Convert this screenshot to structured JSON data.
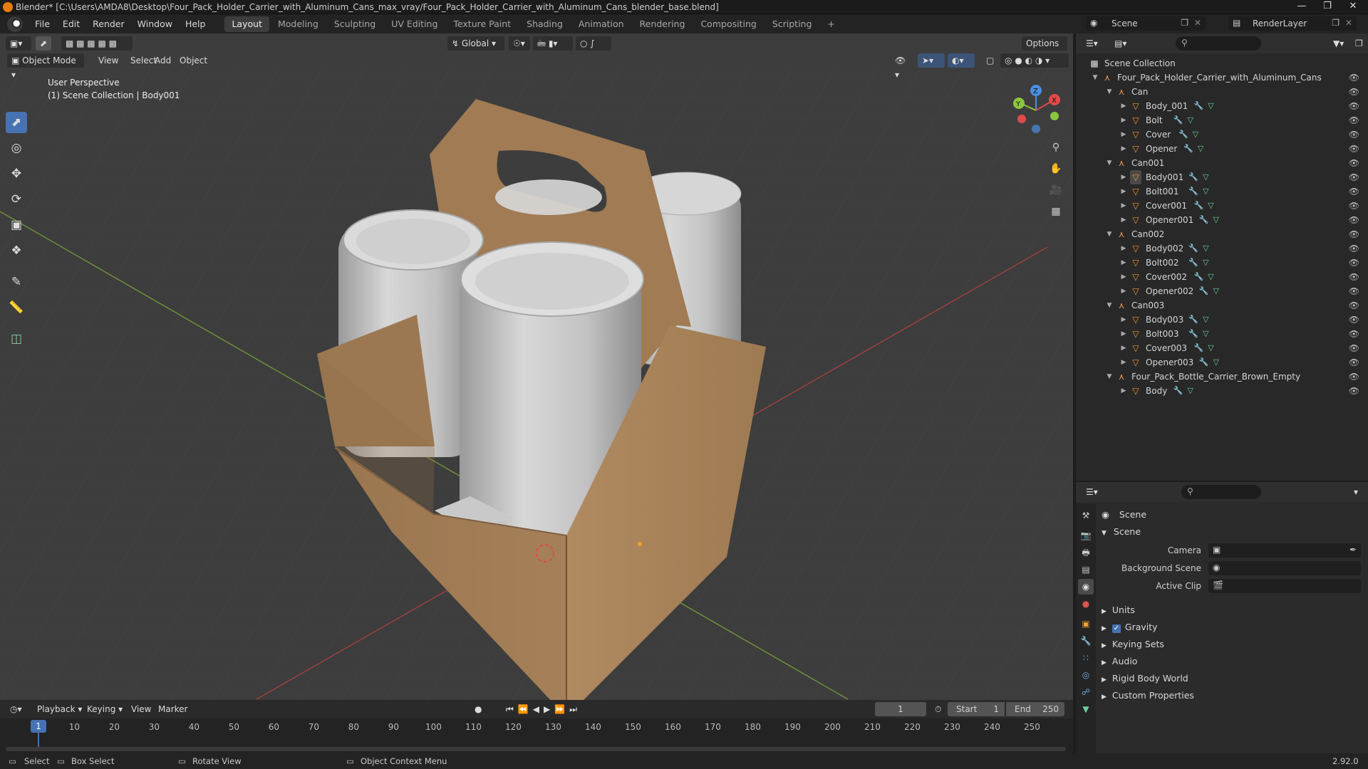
{
  "titlebar": {
    "text": "Blender* [C:\\Users\\AMDA8\\Desktop\\Four_Pack_Holder_Carrier_with_Aluminum_Cans_max_vray/Four_Pack_Holder_Carrier_with_Aluminum_Cans_blender_base.blend]"
  },
  "menubar": {
    "menus": [
      "File",
      "Edit",
      "Render",
      "Window",
      "Help"
    ],
    "workspaces": [
      "Layout",
      "Modeling",
      "Sculpting",
      "UV Editing",
      "Texture Paint",
      "Shading",
      "Animation",
      "Rendering",
      "Compositing",
      "Scripting"
    ],
    "active_workspace": "Layout",
    "add_tab": "+",
    "scene_name": "Scene",
    "layer_name": "RenderLayer"
  },
  "viewport": {
    "mode": "Object Mode",
    "menus": [
      "View",
      "Select",
      "Add",
      "Object"
    ],
    "transform_orientation": "Global",
    "options": "Options",
    "info_line1": "User Perspective",
    "info_line2": "(1) Scene Collection | Body001",
    "axes": {
      "x": "X",
      "y": "Y",
      "z": "Z"
    }
  },
  "outliner": {
    "root": "Scene Collection",
    "rows": [
      {
        "label": "Four_Pack_Holder_Carrier_with_Aluminum_Cans",
        "depth": 0,
        "type": "empty",
        "expanded": true
      },
      {
        "label": "Can",
        "depth": 1,
        "type": "empty",
        "expanded": true
      },
      {
        "label": "Body_001",
        "depth": 2,
        "type": "mesh"
      },
      {
        "label": "Bolt",
        "depth": 2,
        "type": "mesh"
      },
      {
        "label": "Cover",
        "depth": 2,
        "type": "mesh"
      },
      {
        "label": "Opener",
        "depth": 2,
        "type": "mesh"
      },
      {
        "label": "Can001",
        "depth": 1,
        "type": "empty",
        "expanded": true
      },
      {
        "label": "Body001",
        "depth": 2,
        "type": "mesh",
        "selected": true
      },
      {
        "label": "Bolt001",
        "depth": 2,
        "type": "mesh"
      },
      {
        "label": "Cover001",
        "depth": 2,
        "type": "mesh"
      },
      {
        "label": "Opener001",
        "depth": 2,
        "type": "mesh"
      },
      {
        "label": "Can002",
        "depth": 1,
        "type": "empty",
        "expanded": true
      },
      {
        "label": "Body002",
        "depth": 2,
        "type": "mesh"
      },
      {
        "label": "Bolt002",
        "depth": 2,
        "type": "mesh"
      },
      {
        "label": "Cover002",
        "depth": 2,
        "type": "mesh"
      },
      {
        "label": "Opener002",
        "depth": 2,
        "type": "mesh"
      },
      {
        "label": "Can003",
        "depth": 1,
        "type": "empty",
        "expanded": true
      },
      {
        "label": "Body003",
        "depth": 2,
        "type": "mesh"
      },
      {
        "label": "Bolt003",
        "depth": 2,
        "type": "mesh"
      },
      {
        "label": "Cover003",
        "depth": 2,
        "type": "mesh"
      },
      {
        "label": "Opener003",
        "depth": 2,
        "type": "mesh"
      },
      {
        "label": "Four_Pack_Bottle_Carrier_Brown_Empty",
        "depth": 1,
        "type": "empty",
        "expanded": true
      },
      {
        "label": "Body",
        "depth": 2,
        "type": "mesh"
      }
    ]
  },
  "properties": {
    "context": "Scene",
    "panel": "Scene",
    "fields": [
      {
        "label": "Camera"
      },
      {
        "label": "Background Scene"
      },
      {
        "label": "Active Clip"
      }
    ],
    "sections": [
      "Units",
      "Gravity",
      "Keying Sets",
      "Audio",
      "Rigid Body World",
      "Custom Properties"
    ],
    "gravity_checked": true
  },
  "timeline": {
    "menus": [
      "Playback",
      "Keying",
      "View",
      "Marker"
    ],
    "current_frame": "1",
    "start_label": "Start",
    "start": "1",
    "end_label": "End",
    "end": "250",
    "ticks": [
      "10",
      "20",
      "30",
      "40",
      "50",
      "60",
      "70",
      "80",
      "90",
      "100",
      "110",
      "120",
      "130",
      "140",
      "150",
      "160",
      "170",
      "180",
      "190",
      "200",
      "210",
      "220",
      "230",
      "240",
      "250"
    ],
    "playhead": "1"
  },
  "statusbar": {
    "select": "Select",
    "box_select": "Box Select",
    "rotate_view": "Rotate View",
    "context_menu": "Object Context Menu",
    "version": "2.92.0"
  },
  "colors": {
    "accent": "#4772b3",
    "cardboard": "#a8835c",
    "can": "#c9c9c9",
    "x_axis": "#e04a4a",
    "y_axis": "#8cc63e",
    "z_axis": "#4a8fe0"
  }
}
